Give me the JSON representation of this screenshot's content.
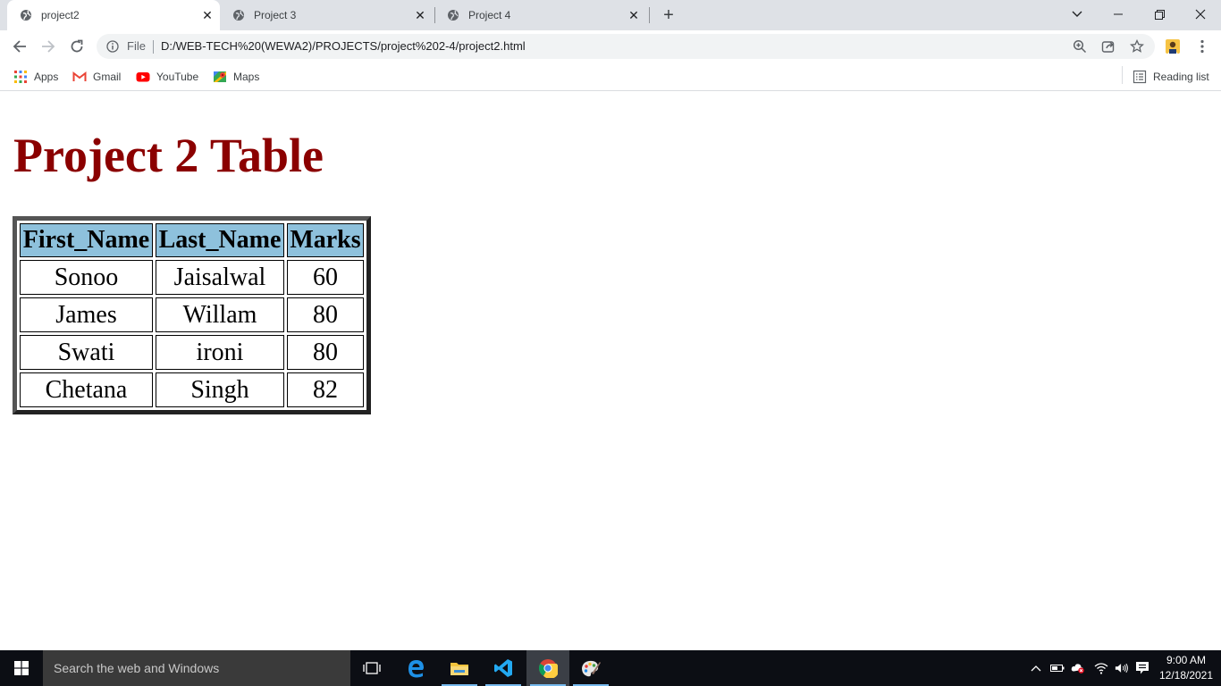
{
  "browser": {
    "tabs": [
      {
        "title": "project2",
        "active": true
      },
      {
        "title": "Project 3",
        "active": false
      },
      {
        "title": "Project 4",
        "active": false
      }
    ],
    "address": {
      "scheme_label": "File",
      "url": "D:/WEB-TECH%20(WEWA2)/PROJECTS/project%202-4/project2.html"
    },
    "bookmarks": [
      {
        "label": "Apps",
        "icon": "apps-grid-icon"
      },
      {
        "label": "Gmail",
        "icon": "gmail-icon"
      },
      {
        "label": "YouTube",
        "icon": "youtube-icon"
      },
      {
        "label": "Maps",
        "icon": "maps-icon"
      }
    ],
    "reading_list_label": "Reading list"
  },
  "page": {
    "title": "Project 2 Table",
    "table": {
      "headers": [
        "First_Name",
        "Last_Name",
        "Marks"
      ],
      "rows": [
        [
          "Sonoo",
          "Jaisalwal",
          "60"
        ],
        [
          "James",
          "Willam",
          "80"
        ],
        [
          "Swati",
          "ironi",
          "80"
        ],
        [
          "Chetana",
          "Singh",
          "82"
        ]
      ]
    }
  },
  "taskbar": {
    "search_placeholder": "Search the web and Windows",
    "time": "9:00 AM",
    "date": "12/18/2021"
  },
  "colors": {
    "title": "#8b0000",
    "header_bg": "#8ec1dc",
    "taskbar_bg": "#0c0e14",
    "tabstrip_bg": "#dee1e6"
  }
}
